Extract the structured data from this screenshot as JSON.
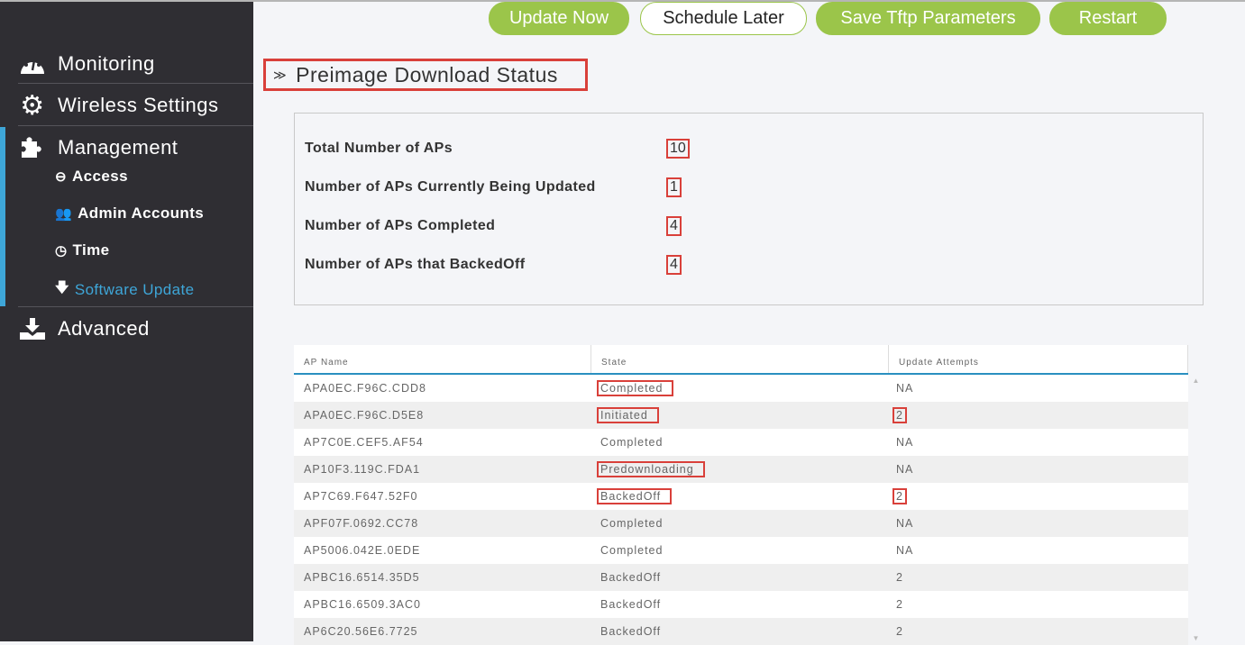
{
  "sidebar": {
    "items": [
      {
        "label": "Monitoring",
        "icon": "dashboard-icon"
      },
      {
        "label": "Wireless Settings",
        "icon": "gear-icon"
      },
      {
        "label": "Management",
        "icon": "puzzle-icon"
      },
      {
        "label": "Advanced",
        "icon": "download-tray-icon"
      }
    ],
    "subitems": [
      {
        "label": "Access",
        "icon": "minus-circle-icon"
      },
      {
        "label": "Admin Accounts",
        "icon": "users-icon"
      },
      {
        "label": "Time",
        "icon": "clock-icon"
      },
      {
        "label": "Software Update",
        "icon": "arrow-down-icon",
        "active": true
      }
    ]
  },
  "toolbar": {
    "update_now": "Update Now",
    "schedule_later": "Schedule Later",
    "save_tftp": "Save Tftp Parameters",
    "restart": "Restart"
  },
  "section": {
    "title": "Preimage Download Status"
  },
  "summary": [
    {
      "label": "Total Number of APs",
      "value": "10"
    },
    {
      "label": "Number of APs Currently Being Updated",
      "value": "1"
    },
    {
      "label": "Number of APs Completed",
      "value": "4"
    },
    {
      "label": "Number of APs that BackedOff",
      "value": "4"
    }
  ],
  "table": {
    "headers": [
      "AP Name",
      "State",
      "Update Attempts"
    ],
    "rows": [
      {
        "name": "APA0EC.F96C.CDD8",
        "state": "Completed",
        "attempts": "NA",
        "hl_state": true,
        "hl_att": false
      },
      {
        "name": "APA0EC.F96C.D5E8",
        "state": "Initiated",
        "attempts": "2",
        "hl_state": true,
        "hl_att": true
      },
      {
        "name": "AP7C0E.CEF5.AF54",
        "state": "Completed",
        "attempts": "NA",
        "hl_state": false,
        "hl_att": false
      },
      {
        "name": "AP10F3.119C.FDA1",
        "state": "Predownloading",
        "attempts": "NA",
        "hl_state": true,
        "hl_att": false
      },
      {
        "name": "AP7C69.F647.52F0",
        "state": "BackedOff",
        "attempts": "2",
        "hl_state": true,
        "hl_att": true
      },
      {
        "name": "APF07F.0692.CC78",
        "state": "Completed",
        "attempts": "NA",
        "hl_state": false,
        "hl_att": false
      },
      {
        "name": "AP5006.042E.0EDE",
        "state": "Completed",
        "attempts": "NA",
        "hl_state": false,
        "hl_att": false
      },
      {
        "name": "APBC16.6514.35D5",
        "state": "BackedOff",
        "attempts": "2",
        "hl_state": false,
        "hl_att": false
      },
      {
        "name": "APBC16.6509.3AC0",
        "state": "BackedOff",
        "attempts": "2",
        "hl_state": false,
        "hl_att": false
      },
      {
        "name": "AP6C20.56E6.7725",
        "state": "BackedOff",
        "attempts": "2",
        "hl_state": false,
        "hl_att": false
      }
    ]
  },
  "colors": {
    "accent": "#9bc54a",
    "active": "#3ea6d8",
    "highlight": "#d9403a",
    "sidebar": "#2f2e33"
  }
}
